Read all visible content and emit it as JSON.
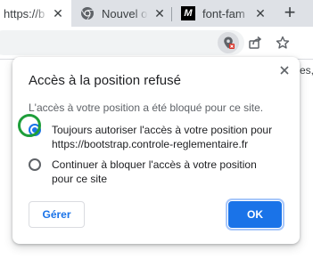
{
  "tabs": [
    {
      "title": "https://b",
      "active": true
    },
    {
      "title": "Nouvel o",
      "active": false
    },
    {
      "title": "font-fam",
      "active": false
    }
  ],
  "icons": {
    "tab1_close": "close-icon",
    "tab2_favicon": "chrome-icon",
    "tab2_close": "close-icon",
    "tab3_favicon": "mdn-icon",
    "tab3_close": "close-icon",
    "new_tab": "plus-icon",
    "location_blocked": "location-blocked-icon",
    "share": "share-icon",
    "bookmark": "star-icon",
    "popup_close": "close-icon"
  },
  "new_tab_symbol": "+",
  "bookmarks_hint": "es,",
  "popup": {
    "title": "Accès à la position refusé",
    "message": "L'accès à votre position a été bloqué pour ce site.",
    "options": [
      {
        "line1": "Toujours autoriser l'accès à votre position pour",
        "line2": "https://bootstrap.controle-reglementaire.fr",
        "selected": true
      },
      {
        "line1": "Continuer à bloquer l'accès à votre position",
        "line2": "pour ce site",
        "selected": false
      }
    ],
    "manage_label": "Gérer",
    "ok_label": "OK"
  },
  "colors": {
    "accent": "#1a73e8",
    "highlight_ring": "#1e9e3a",
    "blocked_badge": "#d93025"
  }
}
